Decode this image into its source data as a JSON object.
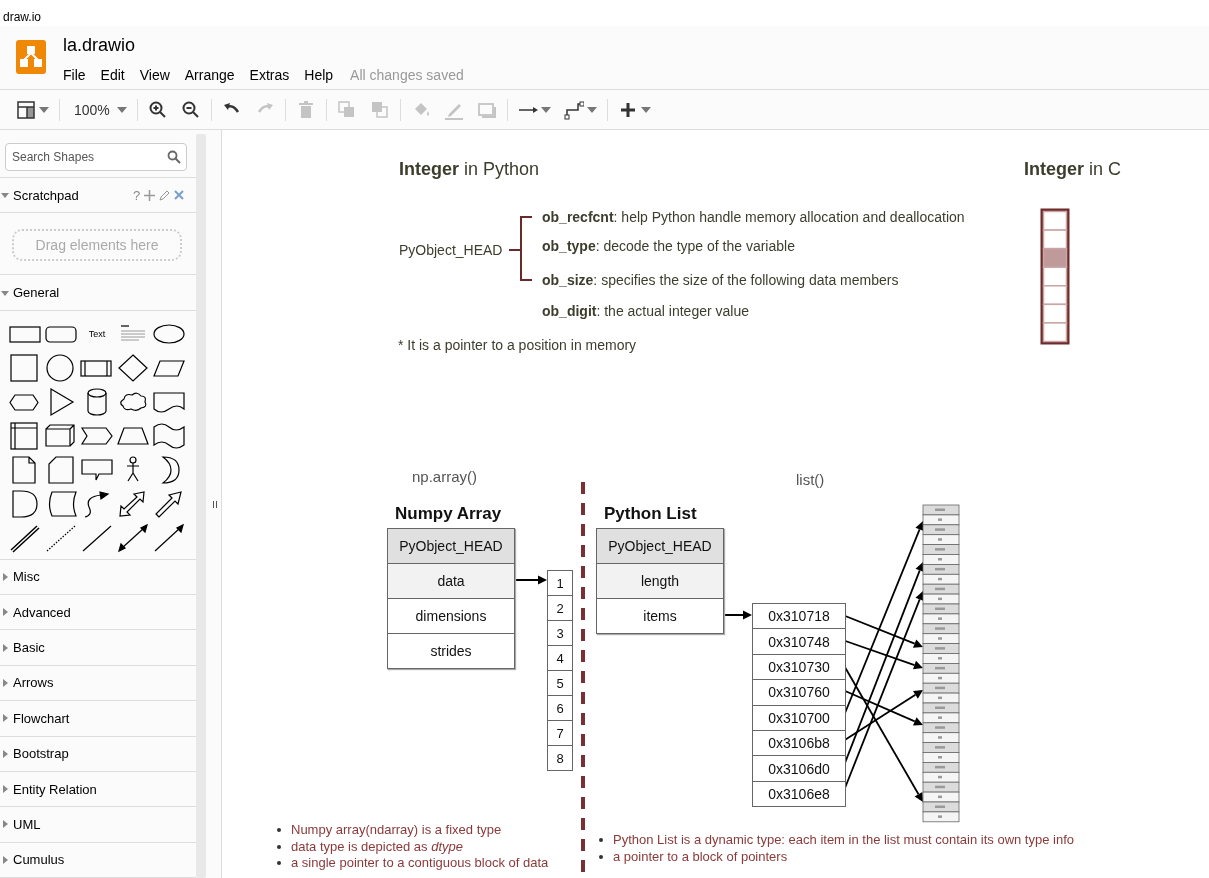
{
  "browser_tab": {
    "title": "draw.io"
  },
  "header": {
    "file_name": "la.drawio",
    "menu": [
      "File",
      "Edit",
      "View",
      "Arrange",
      "Extras",
      "Help"
    ],
    "save_status": "All changes saved"
  },
  "toolbar": {
    "zoom": "100%",
    "tool_groups": [
      [
        {
          "kind": "format",
          "disabled": false
        }
      ],
      [
        {
          "kind": "zoom",
          "disabled": false
        }
      ],
      [
        {
          "kind": "zoom-in",
          "disabled": false
        },
        {
          "kind": "zoom-out",
          "disabled": false
        }
      ],
      [
        {
          "kind": "undo",
          "disabled": false
        },
        {
          "kind": "redo",
          "disabled": true
        }
      ],
      [
        {
          "kind": "delete",
          "disabled": true
        }
      ],
      [
        {
          "kind": "to-front",
          "disabled": true
        },
        {
          "kind": "to-back",
          "disabled": true
        }
      ],
      [
        {
          "kind": "fill",
          "disabled": true
        },
        {
          "kind": "line",
          "disabled": true
        },
        {
          "kind": "shadow",
          "disabled": true
        }
      ],
      [
        {
          "kind": "connection",
          "disabled": false
        },
        {
          "kind": "waypoints",
          "disabled": false
        }
      ],
      [
        {
          "kind": "insert",
          "disabled": false
        }
      ]
    ]
  },
  "sidebar": {
    "search": {
      "placeholder": "Search Shapes"
    },
    "scratchpad": {
      "title": "Scratchpad",
      "expanded": true,
      "help": "?",
      "drop_hint": "Drag elements here"
    },
    "general": {
      "title": "General",
      "expanded": true,
      "text_shape": "Text"
    },
    "categories": [
      {
        "title": "Misc",
        "expanded": false
      },
      {
        "title": "Advanced",
        "expanded": false
      },
      {
        "title": "Basic",
        "expanded": false
      },
      {
        "title": "Arrows",
        "expanded": false
      },
      {
        "title": "Flowchart",
        "expanded": false
      },
      {
        "title": "Bootstrap",
        "expanded": false
      },
      {
        "title": "Entity Relation",
        "expanded": false
      },
      {
        "title": "UML",
        "expanded": false
      },
      {
        "title": "Cumulus",
        "expanded": false
      }
    ]
  },
  "diagram": {
    "integer_python": {
      "title": "**Integer** in Python",
      "head_label": "PyObject_HEAD",
      "fields": [
        "**ob_recfcnt**: help Python handle memory allocation and deallocation",
        "**ob_type**: decode the type of the variable",
        "**ob_size**: specifies the size of the following data members",
        "**ob_digit**: the actual integer value"
      ],
      "note": "* It is a pointer to a position in memory"
    },
    "integer_c": {
      "title": "**Integer** in C",
      "cells": [
        {
          "highlighted": false
        },
        {
          "highlighted": false
        },
        {
          "highlighted": true
        },
        {
          "highlighted": false
        },
        {
          "highlighted": false
        },
        {
          "highlighted": false
        },
        {
          "highlighted": false
        }
      ]
    },
    "numpy": {
      "caption": "np.array()",
      "title": "Numpy Array",
      "rows": [
        {
          "label": "PyObject_HEAD",
          "kind": "header"
        },
        {
          "label": "data",
          "kind": "highlighted"
        },
        {
          "label": "dimensions",
          "kind": "plain"
        },
        {
          "label": "strides",
          "kind": "plain"
        }
      ],
      "buffer": [
        "1",
        "2",
        "3",
        "4",
        "5",
        "6",
        "7",
        "8"
      ],
      "bullets": [
        "Numpy array(ndarray) is a fixed type",
        "data type is depicted as *dtype*",
        "a single pointer to a contiguous block of data"
      ]
    },
    "list": {
      "caption": "list()",
      "title": "Python List",
      "rows": [
        {
          "label": "PyObject_HEAD",
          "kind": "header"
        },
        {
          "label": "length",
          "kind": "highlighted"
        },
        {
          "label": "items",
          "kind": "plain"
        }
      ],
      "addresses": [
        "0x310718",
        "0x310748",
        "0x310730",
        "0x310760",
        "0x310700",
        "0x3106b8",
        "0x3106d0",
        "0x3106e8"
      ],
      "bullets": [
        "Python List is a dynamic type: each item in the list must contain its own type info",
        "a pointer to a block of pointers"
      ]
    }
  }
}
